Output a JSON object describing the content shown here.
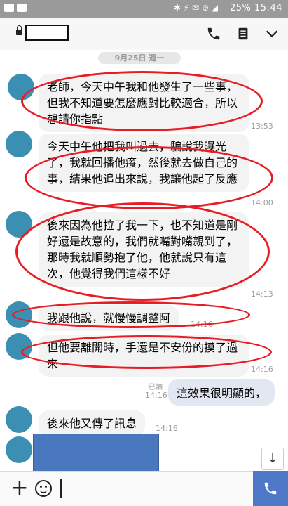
{
  "statusbar": {
    "time": "15:44",
    "battery": "25%",
    "sys_icons": "✱ ⚡ ✉ ⊕ ◢"
  },
  "header": {
    "icons": [
      "lock-icon",
      "phone-icon",
      "menu-icon",
      "chevron-down-icon"
    ]
  },
  "chat": {
    "date": "9月25日 週一",
    "messages": [
      {
        "text": "老師，今天中午我和他發生了一些事，但我不知道要怎麼應對比較適合，所以想請你指點",
        "time": "13:53"
      },
      {
        "text": "今天中午他把我叫過去，騙說我曝光了，我就回播他癢，然後就去做自己的事，結果他追出來說，我讓他起了反應",
        "time": "14:00"
      },
      {
        "text": "後來因為他拉了我一下，也不知道是剛好還是故意的，我們就嘴對嘴親到了，那時我就順勢抱了他，他就說只有這次，他覺得我們這樣不好",
        "time": "14:13"
      },
      {
        "text": "我跟他說，就慢慢調整阿",
        "time": "14:16"
      },
      {
        "text": "但他要離開時，手還是不安份的摸了過來",
        "time": "14:16"
      },
      {
        "text": "後來他又傳了訊息",
        "time": "14:16"
      }
    ],
    "my_message": {
      "text": "這效果很明顯的，",
      "read": "已讀",
      "time": "14:16"
    }
  },
  "input": {
    "colors": {
      "accent": "#4f78c9",
      "avatar": "#3b8fb3",
      "highlight": "#e81d24"
    }
  }
}
